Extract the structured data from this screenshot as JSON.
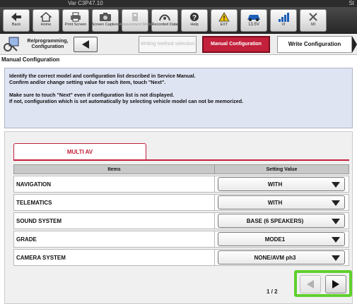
{
  "title_strip": {
    "version": "Var C3P47.10",
    "right": "St"
  },
  "toolbar": {
    "back": "Back",
    "home": "Home",
    "print": "Print Screen",
    "capture": "Screen Capture",
    "measurement": "Measurement Mode",
    "recorded": "Recorded Data",
    "help": "Help",
    "ext": "EXT",
    "voltage": "13.5V",
    "vi": "VI",
    "mi": "MI"
  },
  "steps": {
    "reprogramming": "Re/programming, Configuration",
    "writing_method": "Writing method selection",
    "manual": "Manual Configuration",
    "write": "Write Configuration"
  },
  "page_title": "Manual Configuration",
  "instructions": {
    "line1": "Identify the correct model and configuration list described in Service Manual.",
    "line2": "Confirm and/or change setting value for each item, touch \"Next\".",
    "line3": "Make sure to touch \"Next\" even if configuration list is not displayed.",
    "line4": "If not, configuration which is set automatically by selecting vehicle model can not be memorized."
  },
  "tab": {
    "label": "MULTI AV"
  },
  "table": {
    "col_items": "Items",
    "col_value": "Setting Value",
    "rows": [
      {
        "item": "NAVIGATION",
        "value": "WITH"
      },
      {
        "item": "TELEMATICS",
        "value": "WITH"
      },
      {
        "item": "SOUND SYSTEM",
        "value": "BASE (6 SPEAKERS)"
      },
      {
        "item": "GRADE",
        "value": "MODE1"
      },
      {
        "item": "CAMERA SYSTEM",
        "value": "NONE/AVM ph3"
      }
    ]
  },
  "pager": {
    "text": "1 / 2"
  },
  "colors": {
    "accent": "#c3203b",
    "highlight": "#5fd02d",
    "instruction_bg": "#dfe4f2"
  }
}
